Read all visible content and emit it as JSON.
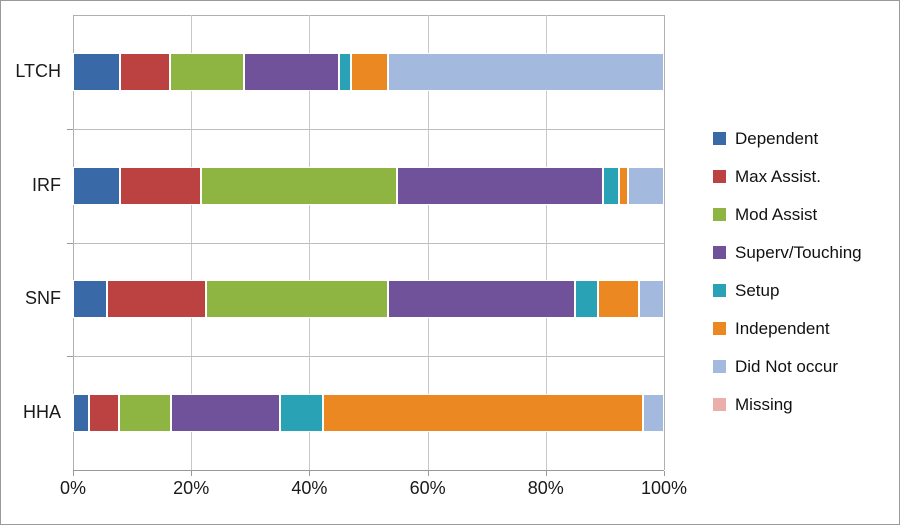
{
  "chart_data": {
    "type": "bar",
    "orientation": "horizontal",
    "stacked": true,
    "stack_mode": "percent",
    "title": "",
    "xlabel": "",
    "ylabel": "",
    "xlim": [
      0,
      100
    ],
    "xticks": [
      0,
      20,
      40,
      60,
      80,
      100
    ],
    "xtick_labels": [
      "0%",
      "20%",
      "40%",
      "60%",
      "80%",
      "100%"
    ],
    "grid": true,
    "legend_position": "right",
    "categories": [
      "LTCH",
      "IRF",
      "SNF",
      "HHA"
    ],
    "series": [
      {
        "name": "Dependent",
        "color": "#3a69a8",
        "values": [
          8.0,
          8.0,
          5.8,
          2.7
        ]
      },
      {
        "name": "Max Assist.",
        "color": "#bc4141",
        "values": [
          8.4,
          13.7,
          16.7,
          5.1
        ]
      },
      {
        "name": "Mod Assist",
        "color": "#8eb442",
        "values": [
          12.5,
          33.1,
          30.8,
          8.8
        ]
      },
      {
        "name": "Superv/Touching",
        "color": "#6f5299",
        "values": [
          16.1,
          34.9,
          31.7,
          18.4
        ]
      },
      {
        "name": "Setup",
        "color": "#29a2b5",
        "values": [
          2.0,
          2.7,
          3.8,
          7.3
        ]
      },
      {
        "name": "Independent",
        "color": "#ec8822",
        "values": [
          6.3,
          1.5,
          7.0,
          54.1
        ]
      },
      {
        "name": "Did Not occur",
        "color": "#a3bade",
        "values": [
          46.7,
          6.1,
          4.2,
          3.6
        ]
      },
      {
        "name": "Missing",
        "color": "#eaafa8",
        "values": [
          0.0,
          0.0,
          0.0,
          0.0
        ]
      }
    ]
  },
  "legend": {
    "items": [
      {
        "label": "Dependent"
      },
      {
        "label": "Max Assist."
      },
      {
        "label": "Mod Assist"
      },
      {
        "label": "Superv/Touching"
      },
      {
        "label": "Setup"
      },
      {
        "label": "Independent"
      },
      {
        "label": "Did Not occur"
      },
      {
        "label": "Missing"
      }
    ]
  }
}
